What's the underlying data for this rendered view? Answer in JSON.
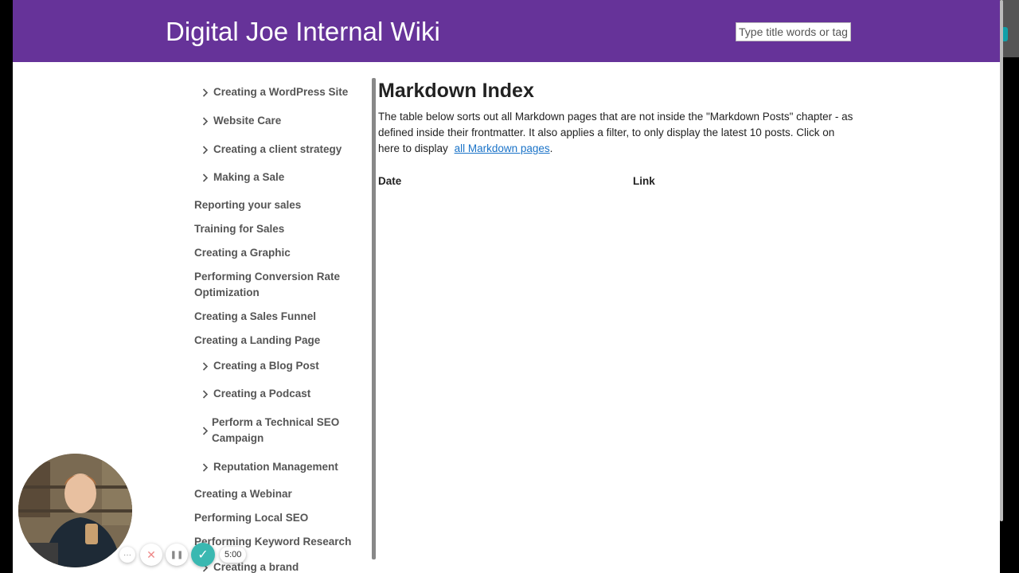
{
  "header": {
    "site_title": "Digital Joe Internal Wiki",
    "search_placeholder": "Type title words or tags"
  },
  "sidebar": {
    "items": [
      {
        "label": "Creating a WordPress Site",
        "expandable": true
      },
      {
        "label": "Website Care",
        "expandable": true
      },
      {
        "label": "Creating a client strategy",
        "expandable": true
      },
      {
        "label": "Making a Sale",
        "expandable": true
      },
      {
        "label": "Reporting your sales",
        "expandable": false
      },
      {
        "label": "Training for Sales",
        "expandable": false
      },
      {
        "label": "Creating a Graphic",
        "expandable": false
      },
      {
        "label": "Performing Conversion Rate",
        "label2": "Optimization",
        "expandable": false
      },
      {
        "label": "Creating a Sales Funnel",
        "expandable": false
      },
      {
        "label": "Creating a Landing Page",
        "expandable": false
      },
      {
        "label": "Creating a Blog Post",
        "expandable": true
      },
      {
        "label": "Creating a Podcast",
        "expandable": true
      },
      {
        "label": "Perform a Technical SEO",
        "label2": "Campaign",
        "expandable": true
      },
      {
        "label": "Reputation Management",
        "expandable": true
      },
      {
        "label": "Creating a Webinar",
        "expandable": false
      },
      {
        "label": "Performing Local SEO",
        "expandable": false
      },
      {
        "label": "Performing Keyword Research",
        "expandable": false
      },
      {
        "label": "Creating a brand",
        "expandable": true
      }
    ]
  },
  "main": {
    "title": "Markdown Index",
    "intro_text": "The table below sorts out all Markdown pages that are not inside the \"Markdown Posts\" chapter - as defined inside their frontmatter. It also applies a filter, to only display the latest 10 posts. Click on here to display ",
    "intro_link": "all Markdown pages",
    "intro_end": ".",
    "table_headers": [
      "Date",
      "Link"
    ]
  },
  "recorder": {
    "more_label": "···",
    "cancel_label": "✕",
    "pause_label": "❚❚",
    "done_label": "✓",
    "timer": "5:00",
    "accent": "#3ab8b1"
  },
  "colors": {
    "header_bg": "#663399",
    "link": "#1a73c8"
  }
}
